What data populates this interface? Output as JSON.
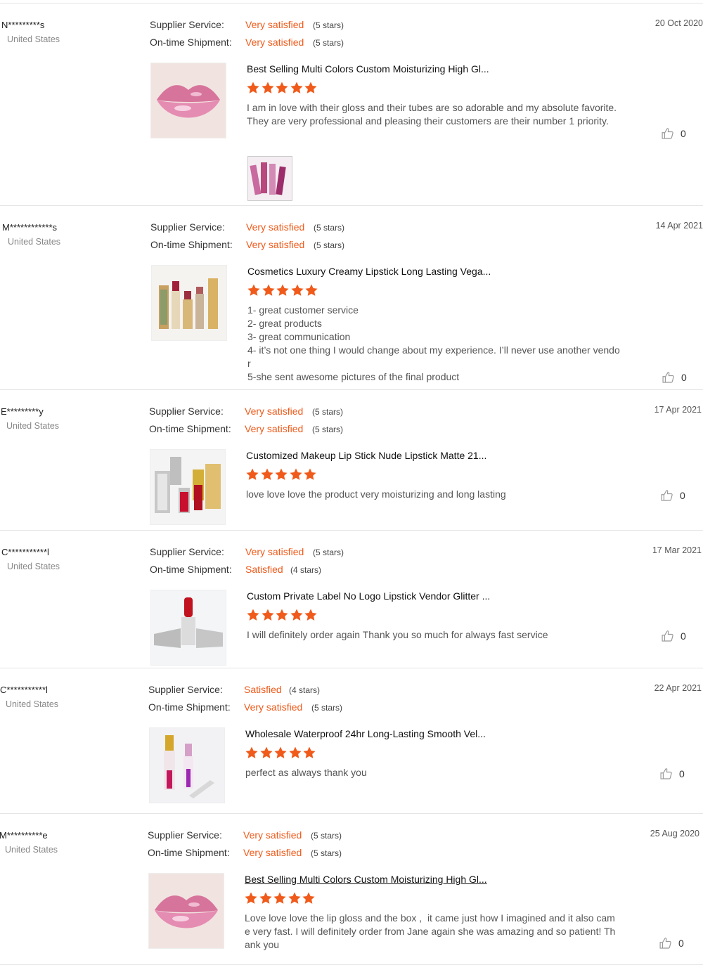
{
  "labels": {
    "supplier_service": "Supplier Service:",
    "ontime_shipment": "On-time Shipment:"
  },
  "colors": {
    "accent": "#f05a1a",
    "separator": "#e5e5e5",
    "muted": "#888888"
  },
  "reviews": [
    {
      "reviewer": "N*********s",
      "country": "United States",
      "date": "20 Oct 2020",
      "supplier_rating": "Very satisfied",
      "supplier_stars": "(5 stars)",
      "shipment_rating": "Very satisfied",
      "shipment_stars": "(5 stars)",
      "product_title": "Best Selling Multi Colors Custom Moisturizing High Gl...",
      "product_image": "lips-gloss-image",
      "stars": 5,
      "text": "I am in love with their gloss and their tubes are so adorable and my absolute favorite. They are very professional and pleasing their customers are their number 1 priority.",
      "likes": "0",
      "attached_image": "lipgloss-tubes-photo"
    },
    {
      "reviewer": "M************s",
      "country": "United States",
      "date": "14 Apr 2021",
      "supplier_rating": "Very satisfied",
      "supplier_stars": "(5 stars)",
      "shipment_rating": "Very satisfied",
      "shipment_stars": "(5 stars)",
      "product_title": "Cosmetics Luxury Creamy Lipstick Long Lasting Vega...",
      "product_image": "gold-lipsticks-image",
      "stars": 5,
      "text": "1- great customer service\n2- great products\n3- great communication\n4- it’s not one thing I would change about my experience. I’ll never use another vendor\n5-she sent awesome pictures of the final product",
      "likes": "0"
    },
    {
      "reviewer": "E*********y",
      "country": "United States",
      "date": "17 Apr 2021",
      "supplier_rating": "Very satisfied",
      "supplier_stars": "(5 stars)",
      "shipment_rating": "Very satisfied",
      "shipment_stars": "(5 stars)",
      "product_title": "Customized Makeup Lip Stick Nude Lipstick Matte 21...",
      "product_image": "textured-lipsticks-image",
      "stars": 5,
      "text": "love love love the product very moisturizing and long lasting",
      "likes": "0"
    },
    {
      "reviewer": "C***********l",
      "country": "United States",
      "date": "17 Mar 2021",
      "supplier_rating": "Very satisfied",
      "supplier_stars": "(5 stars)",
      "shipment_rating": "Satisfied",
      "shipment_stars": "(4 stars)",
      "product_title": "Custom Private Label No Logo Lipstick Vendor Glitter ...",
      "product_image": "glitter-lipstick-image",
      "stars": 5,
      "text": "I will definitely order again Thank you so much for always fast service",
      "likes": "0"
    },
    {
      "reviewer": "C***********l",
      "country": "United States",
      "date": "22 Apr 2021",
      "supplier_rating": "Satisfied",
      "supplier_stars": "(4 stars)",
      "shipment_rating": "Very satisfied",
      "shipment_stars": "(5 stars)",
      "product_title": "Wholesale Waterproof 24hr Long-Lasting Smooth Vel...",
      "product_image": "liquid-lipstick-image",
      "stars": 5,
      "text": "perfect as always thank you",
      "likes": "0"
    },
    {
      "reviewer": "M**********e",
      "country": "United States",
      "date": "25 Aug 2020",
      "supplier_rating": "Very satisfied",
      "supplier_stars": "(5 stars)",
      "shipment_rating": "Very satisfied",
      "shipment_stars": "(5 stars)",
      "product_title": "Best Selling Multi Colors Custom Moisturizing High Gl...",
      "product_image": "lips-gloss-image",
      "stars": 5,
      "text": "Love love love the lip gloss and the box ,  it came just how I imagined and it also came very fast. I will definitely order from Jane again she was amazing and so patient! Thank you",
      "likes": "0"
    }
  ]
}
